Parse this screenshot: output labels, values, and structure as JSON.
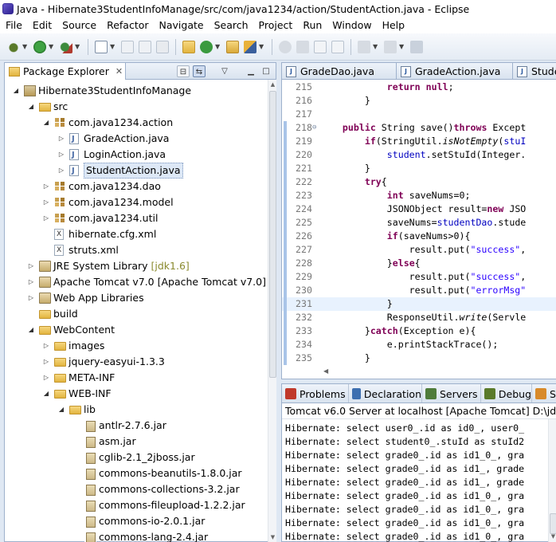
{
  "window": {
    "title": "Java - Hibernate3StudentInfoManage/src/com/java1234/action/StudentAction.java - Eclipse"
  },
  "menu": [
    "File",
    "Edit",
    "Source",
    "Refactor",
    "Navigate",
    "Search",
    "Project",
    "Run",
    "Window",
    "Help"
  ],
  "package_explorer": {
    "tab_label": "Package Explorer",
    "tree": [
      {
        "label": "Hibernate3StudentInfoManage",
        "depth": 0,
        "icon": "project-icon",
        "twisty": "open"
      },
      {
        "label": "src",
        "depth": 1,
        "icon": "source-folder-icon",
        "twisty": "open"
      },
      {
        "label": "com.java1234.action",
        "depth": 2,
        "icon": "package-icon",
        "twisty": "open"
      },
      {
        "label": "GradeAction.java",
        "depth": 3,
        "icon": "java-file-icon",
        "twisty": "closed"
      },
      {
        "label": "LoginAction.java",
        "depth": 3,
        "icon": "java-file-icon",
        "twisty": "closed"
      },
      {
        "label": "StudentAction.java",
        "depth": 3,
        "icon": "java-file-icon",
        "twisty": "closed",
        "selected": true
      },
      {
        "label": "com.java1234.dao",
        "depth": 2,
        "icon": "package-icon",
        "twisty": "closed"
      },
      {
        "label": "com.java1234.model",
        "depth": 2,
        "icon": "package-icon",
        "twisty": "closed"
      },
      {
        "label": "com.java1234.util",
        "depth": 2,
        "icon": "package-icon",
        "twisty": "closed"
      },
      {
        "label": "hibernate.cfg.xml",
        "depth": 2,
        "icon": "xml-file-icon",
        "twisty": "none"
      },
      {
        "label": "struts.xml",
        "depth": 2,
        "icon": "xml-file-icon",
        "twisty": "none"
      },
      {
        "label": "JRE System Library",
        "decoration": "[jdk1.6]",
        "depth": 1,
        "icon": "library-icon",
        "twisty": "closed"
      },
      {
        "label": "Apache Tomcat v7.0 [Apache Tomcat v7.0]",
        "depth": 1,
        "icon": "library-icon",
        "twisty": "closed"
      },
      {
        "label": "Web App Libraries",
        "depth": 1,
        "icon": "library-icon",
        "twisty": "closed"
      },
      {
        "label": "build",
        "depth": 1,
        "icon": "folder-icon",
        "twisty": "none"
      },
      {
        "label": "WebContent",
        "depth": 1,
        "icon": "folder-icon",
        "twisty": "open"
      },
      {
        "label": "images",
        "depth": 2,
        "icon": "folder-icon",
        "twisty": "closed"
      },
      {
        "label": "jquery-easyui-1.3.3",
        "depth": 2,
        "icon": "folder-icon",
        "twisty": "closed"
      },
      {
        "label": "META-INF",
        "depth": 2,
        "icon": "folder-icon",
        "twisty": "closed"
      },
      {
        "label": "WEB-INF",
        "depth": 2,
        "icon": "folder-icon",
        "twisty": "open"
      },
      {
        "label": "lib",
        "depth": 3,
        "icon": "folder-icon",
        "twisty": "open"
      },
      {
        "label": "antlr-2.7.6.jar",
        "depth": 4,
        "icon": "jar-icon",
        "twisty": "none"
      },
      {
        "label": "asm.jar",
        "depth": 4,
        "icon": "jar-icon",
        "twisty": "none"
      },
      {
        "label": "cglib-2.1_2jboss.jar",
        "depth": 4,
        "icon": "jar-icon",
        "twisty": "none"
      },
      {
        "label": "commons-beanutils-1.8.0.jar",
        "depth": 4,
        "icon": "jar-icon",
        "twisty": "none"
      },
      {
        "label": "commons-collections-3.2.jar",
        "depth": 4,
        "icon": "jar-icon",
        "twisty": "none"
      },
      {
        "label": "commons-fileupload-1.2.2.jar",
        "depth": 4,
        "icon": "jar-icon",
        "twisty": "none"
      },
      {
        "label": "commons-io-2.0.1.jar",
        "depth": 4,
        "icon": "jar-icon",
        "twisty": "none"
      },
      {
        "label": "commons-lang-2.4.jar",
        "depth": 4,
        "icon": "jar-icon",
        "twisty": "none"
      }
    ]
  },
  "editor": {
    "tabs": [
      "GradeDao.java",
      "GradeAction.java",
      "Studer"
    ],
    "lines": [
      {
        "n": "215",
        "html": "            <span class=\"kw\">return</span> <span class=\"kw\">null</span>;"
      },
      {
        "n": "216",
        "html": "        }"
      },
      {
        "n": "217",
        "html": ""
      },
      {
        "n": "218",
        "html": "    <span class=\"kw\">public</span> String save()<span class=\"kw\">throws</span> Except"
      },
      {
        "n": "219",
        "html": "        <span class=\"kw\">if</span>(StringUtil.<span class=\"sm\">isNotEmpty</span>(<span class=\"fld\">stuI</span>"
      },
      {
        "n": "220",
        "html": "            <span class=\"fld\">student</span>.setStuId(Integer."
      },
      {
        "n": "221",
        "html": "        }"
      },
      {
        "n": "222",
        "html": "        <span class=\"kw\">try</span>{"
      },
      {
        "n": "223",
        "html": "            <span class=\"kw\">int</span> saveNums=0;"
      },
      {
        "n": "224",
        "html": "            JSONObject result=<span class=\"kw\">new</span> JSO"
      },
      {
        "n": "225",
        "html": "            saveNums=<span class=\"fld\">studentDao</span>.stude"
      },
      {
        "n": "226",
        "html": "            <span class=\"kw\">if</span>(saveNums&gt;0){"
      },
      {
        "n": "227",
        "html": "                result.put(<span class=\"str\">\"success\"</span>,"
      },
      {
        "n": "228",
        "html": "            }<span class=\"kw\">else</span>{"
      },
      {
        "n": "229",
        "html": "                result.put(<span class=\"str\">\"success\"</span>,"
      },
      {
        "n": "230",
        "html": "                result.put(<span class=\"str\">\"errorMsg\"</span>"
      },
      {
        "n": "231",
        "html": "            }"
      },
      {
        "n": "232",
        "html": "            ResponseUtil.<span class=\"sm\">write</span>(Servle"
      },
      {
        "n": "233",
        "html": "        }<span class=\"kw\">catch</span>(Exception e){"
      },
      {
        "n": "234",
        "html": "            e.printStackTrace();"
      },
      {
        "n": "235",
        "html": "        }"
      }
    ]
  },
  "console": {
    "tabs": [
      "Problems",
      "Declaration",
      "Servers",
      "Debug",
      "S"
    ],
    "header": "Tomcat v6.0 Server at localhost [Apache Tomcat] D:\\jdk1.6\\",
    "lines": [
      "Hibernate: select user0_.id as id0_, user0_",
      "Hibernate: select student0_.stuId as stuId2",
      "Hibernate: select grade0_.id as id1_0_, gra",
      "Hibernate: select grade0_.id as id1_, grade",
      "Hibernate: select grade0_.id as id1_, grade",
      "Hibernate: select grade0_.id as id1_0_, gra",
      "Hibernate: select grade0_.id as id1_0_, gra",
      "Hibernate: select grade0_.id as id1_0_, gra",
      "Hibernate: select grade0_.id as id1_0_, gra"
    ]
  }
}
